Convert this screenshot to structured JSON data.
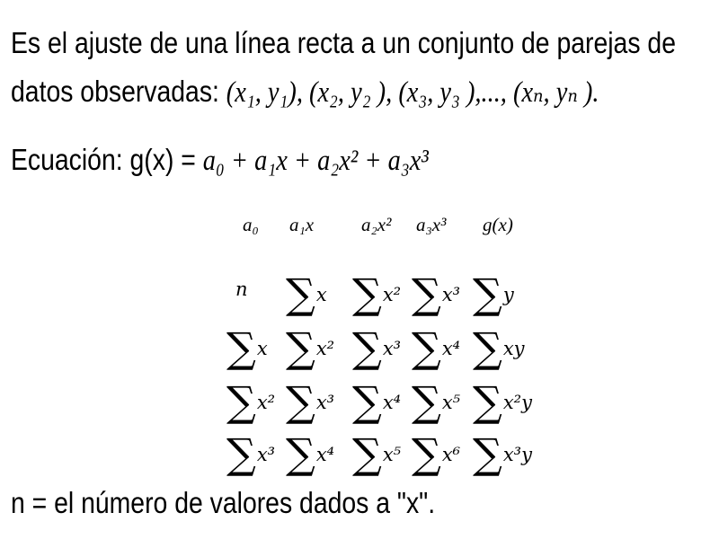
{
  "intro_line1": "Es el ajuste de una línea recta a un conjunto de parejas de",
  "intro_line2_prefix": "datos observadas:",
  "data_pairs": "(x₁, y₁), (x₂, y₂ ), (x₃, y₃ ),..., (xₙ, yₙ ).",
  "equation_label": "Ecuación: g(x) =",
  "equation_rhs": "a₀ + a₁x + a₂x² + a₃x³",
  "column_headers": [
    "a₀",
    "a₁x",
    "a₂x²",
    "a₃x³",
    "g(x)"
  ],
  "matrix_rows": [
    [
      "n",
      "∑x",
      "∑x²",
      "∑x³",
      "∑y"
    ],
    [
      "∑x",
      "∑x²",
      "∑x³",
      "∑x⁴",
      "∑xy"
    ],
    [
      "∑x²",
      "∑x³",
      "∑x⁴",
      "∑x⁵",
      "∑x²y"
    ],
    [
      "∑x³",
      "∑x⁴",
      "∑x⁵",
      "∑x⁶",
      "∑x³y"
    ]
  ],
  "footnote": "n = el número de valores dados a \"x\"."
}
